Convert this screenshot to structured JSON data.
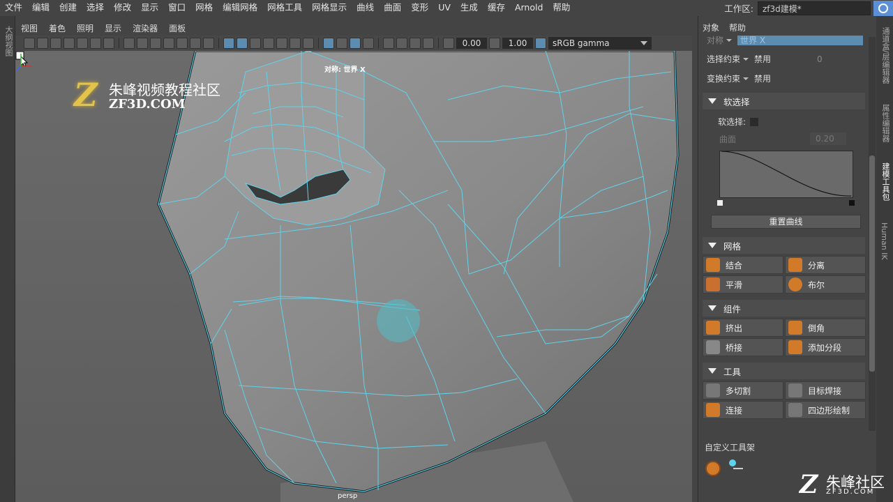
{
  "menubar": {
    "items": [
      "文件",
      "编辑",
      "创建",
      "选择",
      "修改",
      "显示",
      "窗口",
      "网格",
      "编辑网格",
      "网格工具",
      "网格显示",
      "曲线",
      "曲面",
      "变形",
      "UV",
      "生成",
      "缓存",
      "Arnold",
      "帮助"
    ],
    "workspace_label": "工作区:",
    "workspace_value": "zf3d建模*"
  },
  "left_strip": {
    "label": "大纲视图"
  },
  "viewport_menus": [
    "视图",
    "着色",
    "照明",
    "显示",
    "渲染器",
    "面板"
  ],
  "toolbar": {
    "value1": "0.00",
    "value2": "1.00",
    "color_space": "sRGB gamma"
  },
  "viewport": {
    "symmetry_label": "对称: 世界 X",
    "camera_label": "persp",
    "logo": {
      "mark": "Z",
      "cn": "朱峰视频教程社区",
      "en": "ZF3D.COM"
    }
  },
  "panel": {
    "menu": [
      "对象",
      "帮助"
    ],
    "symmetry_row": {
      "label": "对称",
      "value": "世界 X"
    },
    "select_constraint": {
      "label": "选择约束",
      "value": "禁用",
      "num": "0"
    },
    "transform_constraint": {
      "label": "变换约束",
      "value": "禁用"
    },
    "soft_select": {
      "title": "软选择",
      "checkbox_label": "软选择:",
      "falloff_mode": "曲面",
      "falloff_value": "0.20",
      "reset_label": "重置曲线"
    },
    "sections": [
      {
        "title": "网格",
        "buttons": [
          {
            "label": "结合",
            "icon": "combine-icon"
          },
          {
            "label": "分离",
            "icon": "separate-icon"
          },
          {
            "label": "平滑",
            "icon": "smooth-icon"
          },
          {
            "label": "布尔",
            "icon": "boolean-icon"
          }
        ]
      },
      {
        "title": "组件",
        "buttons": [
          {
            "label": "挤出",
            "icon": "extrude-icon"
          },
          {
            "label": "倒角",
            "icon": "bevel-icon"
          },
          {
            "label": "桥接",
            "icon": "bridge-icon"
          },
          {
            "label": "添加分段",
            "icon": "add-divisions-icon"
          }
        ]
      },
      {
        "title": "工具",
        "buttons": [
          {
            "label": "多切割",
            "icon": "multi-cut-icon"
          },
          {
            "label": "目标焊接",
            "icon": "target-weld-icon"
          },
          {
            "label": "连接",
            "icon": "connect-icon"
          },
          {
            "label": "四边形绘制",
            "icon": "quad-draw-icon"
          }
        ]
      }
    ],
    "custom_shelf_title": "自定义工具架"
  },
  "right_tabs": [
    "通道盒/层编辑器",
    "属性编辑器",
    "建模工具包",
    "Human IK"
  ],
  "watermark": {
    "mark": "Z",
    "cn": "朱峰社区",
    "en": "ZF3D.COM"
  },
  "colors": {
    "wire": "#5fd3ea",
    "accent": "#5c8cb0",
    "logo_gold": "#e2c44a"
  }
}
